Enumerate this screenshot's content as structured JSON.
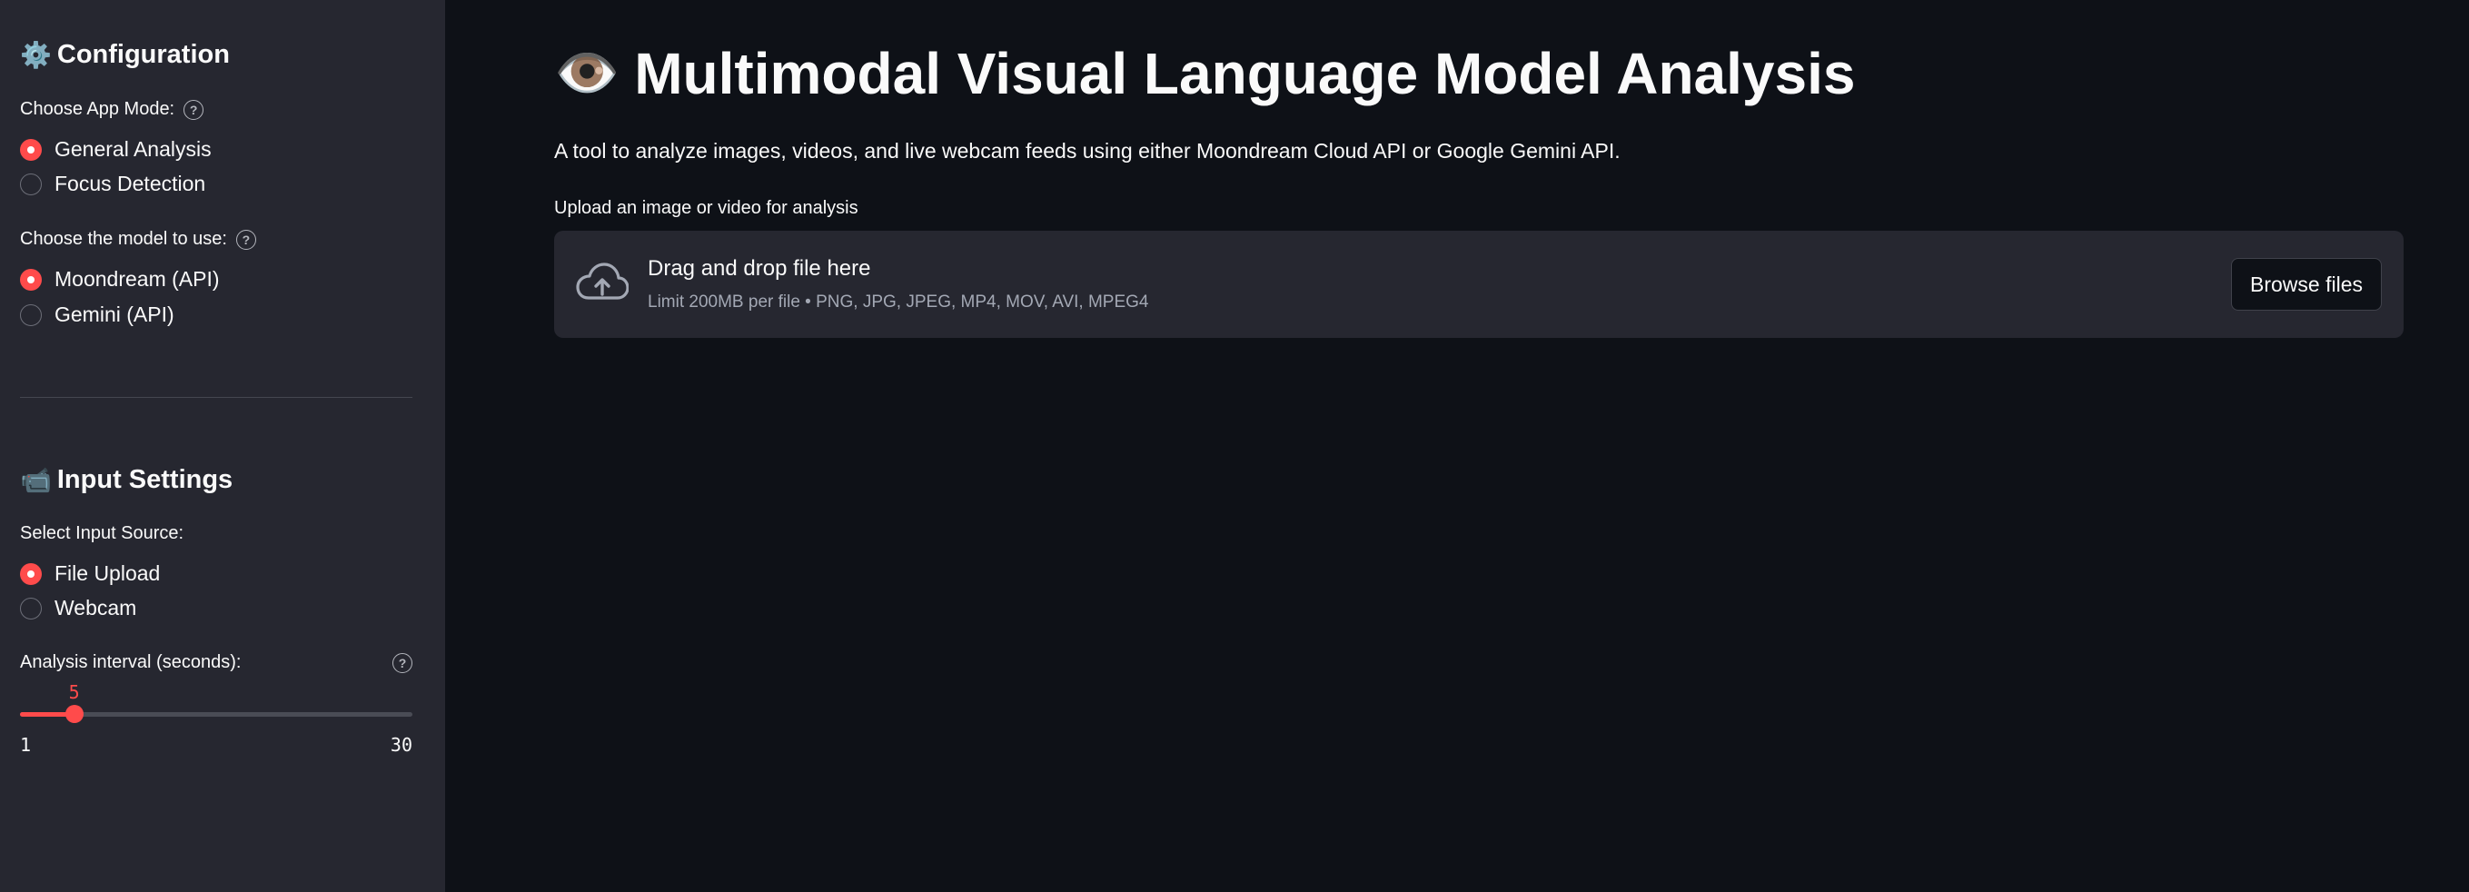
{
  "sidebar": {
    "configuration": {
      "icon": "gear-icon",
      "emoji": "⚙️",
      "title": "Configuration",
      "app_mode": {
        "label": "Choose App Mode:",
        "options": [
          "General Analysis",
          "Focus Detection"
        ],
        "selected": "General Analysis"
      },
      "model": {
        "label": "Choose the model to use:",
        "options": [
          "Moondream (API)",
          "Gemini (API)"
        ],
        "selected": "Moondream (API)"
      }
    },
    "input_settings": {
      "icon": "camera-icon",
      "emoji": "📹",
      "title": "Input Settings",
      "source": {
        "label": "Select Input Source:",
        "options": [
          "File Upload",
          "Webcam"
        ],
        "selected": "File Upload"
      },
      "interval": {
        "label": "Analysis interval (seconds):",
        "value": "5",
        "min": "1",
        "max": "30"
      }
    }
  },
  "main": {
    "title_emoji": "👁️",
    "title": "Multimodal Visual Language Model Analysis",
    "subtitle": "A tool to analyze images, videos, and live webcam feeds using either Moondream Cloud API or Google Gemini API.",
    "uploader": {
      "label": "Upload an image or video for analysis",
      "drop_text": "Drag and drop file here",
      "limit_text": "Limit 200MB per file • PNG, JPG, JPEG, MP4, MOV, AVI, MPEG4",
      "button": "Browse files",
      "icon": "cloud-upload-icon"
    }
  },
  "colors": {
    "accent": "#ff4b4b",
    "background": "#0e1117",
    "sidebar": "#262730",
    "text": "#fafafa"
  }
}
